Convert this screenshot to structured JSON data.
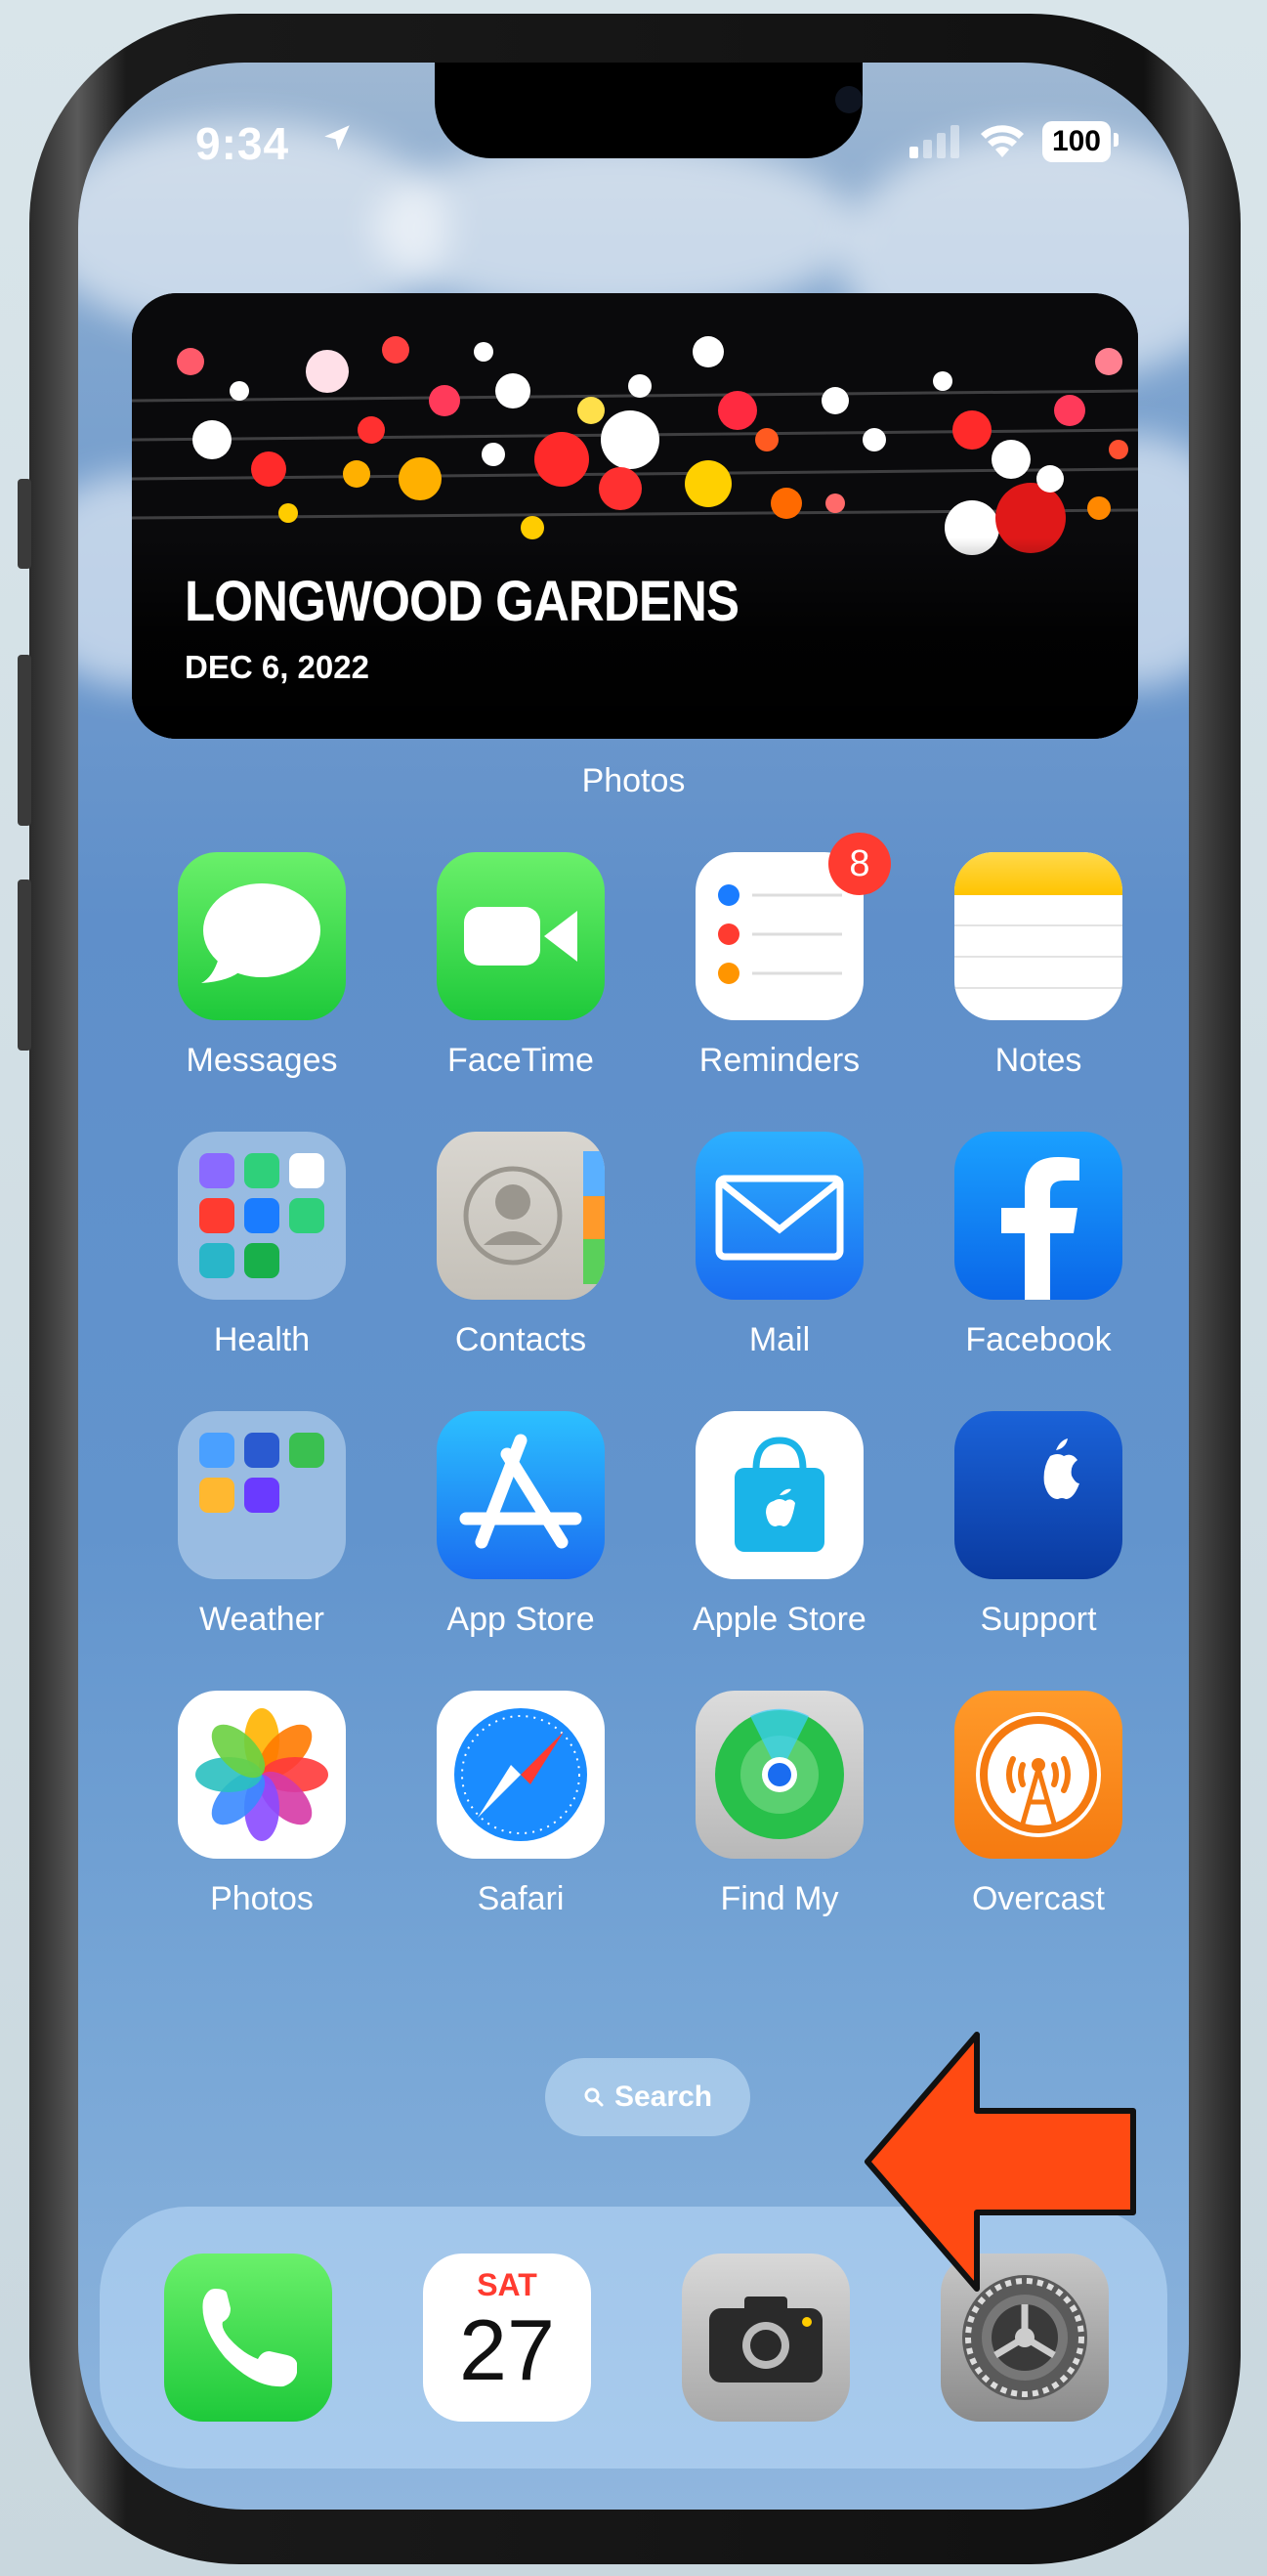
{
  "status_bar": {
    "time": "9:34",
    "battery": "100"
  },
  "widget": {
    "title": "LONGWOOD GARDENS",
    "date": "DEC 6, 2022",
    "label": "Photos"
  },
  "apps": [
    {
      "label": "Messages",
      "icon": "messages-icon"
    },
    {
      "label": "FaceTime",
      "icon": "facetime-icon"
    },
    {
      "label": "Reminders",
      "icon": "reminders-icon",
      "badge": "8"
    },
    {
      "label": "Notes",
      "icon": "notes-icon"
    },
    {
      "label": "Health",
      "icon": "health-folder-icon"
    },
    {
      "label": "Contacts",
      "icon": "contacts-icon"
    },
    {
      "label": "Mail",
      "icon": "mail-icon"
    },
    {
      "label": "Facebook",
      "icon": "facebook-icon"
    },
    {
      "label": "Weather",
      "icon": "weather-folder-icon"
    },
    {
      "label": "App Store",
      "icon": "app-store-icon"
    },
    {
      "label": "Apple Store",
      "icon": "apple-store-icon"
    },
    {
      "label": "Support",
      "icon": "support-icon"
    },
    {
      "label": "Photos",
      "icon": "photos-icon"
    },
    {
      "label": "Safari",
      "icon": "safari-icon"
    },
    {
      "label": "Find My",
      "icon": "find-my-icon"
    },
    {
      "label": "Overcast",
      "icon": "overcast-icon"
    }
  ],
  "search": {
    "label": "Search"
  },
  "dock": {
    "calendar_day": "SAT",
    "calendar_date": "27",
    "items": [
      "phone-icon",
      "calendar-icon",
      "camera-icon",
      "settings-icon"
    ]
  },
  "colors": {
    "annotation_arrow": "#ff4a12",
    "badge": "#ff3b30"
  }
}
